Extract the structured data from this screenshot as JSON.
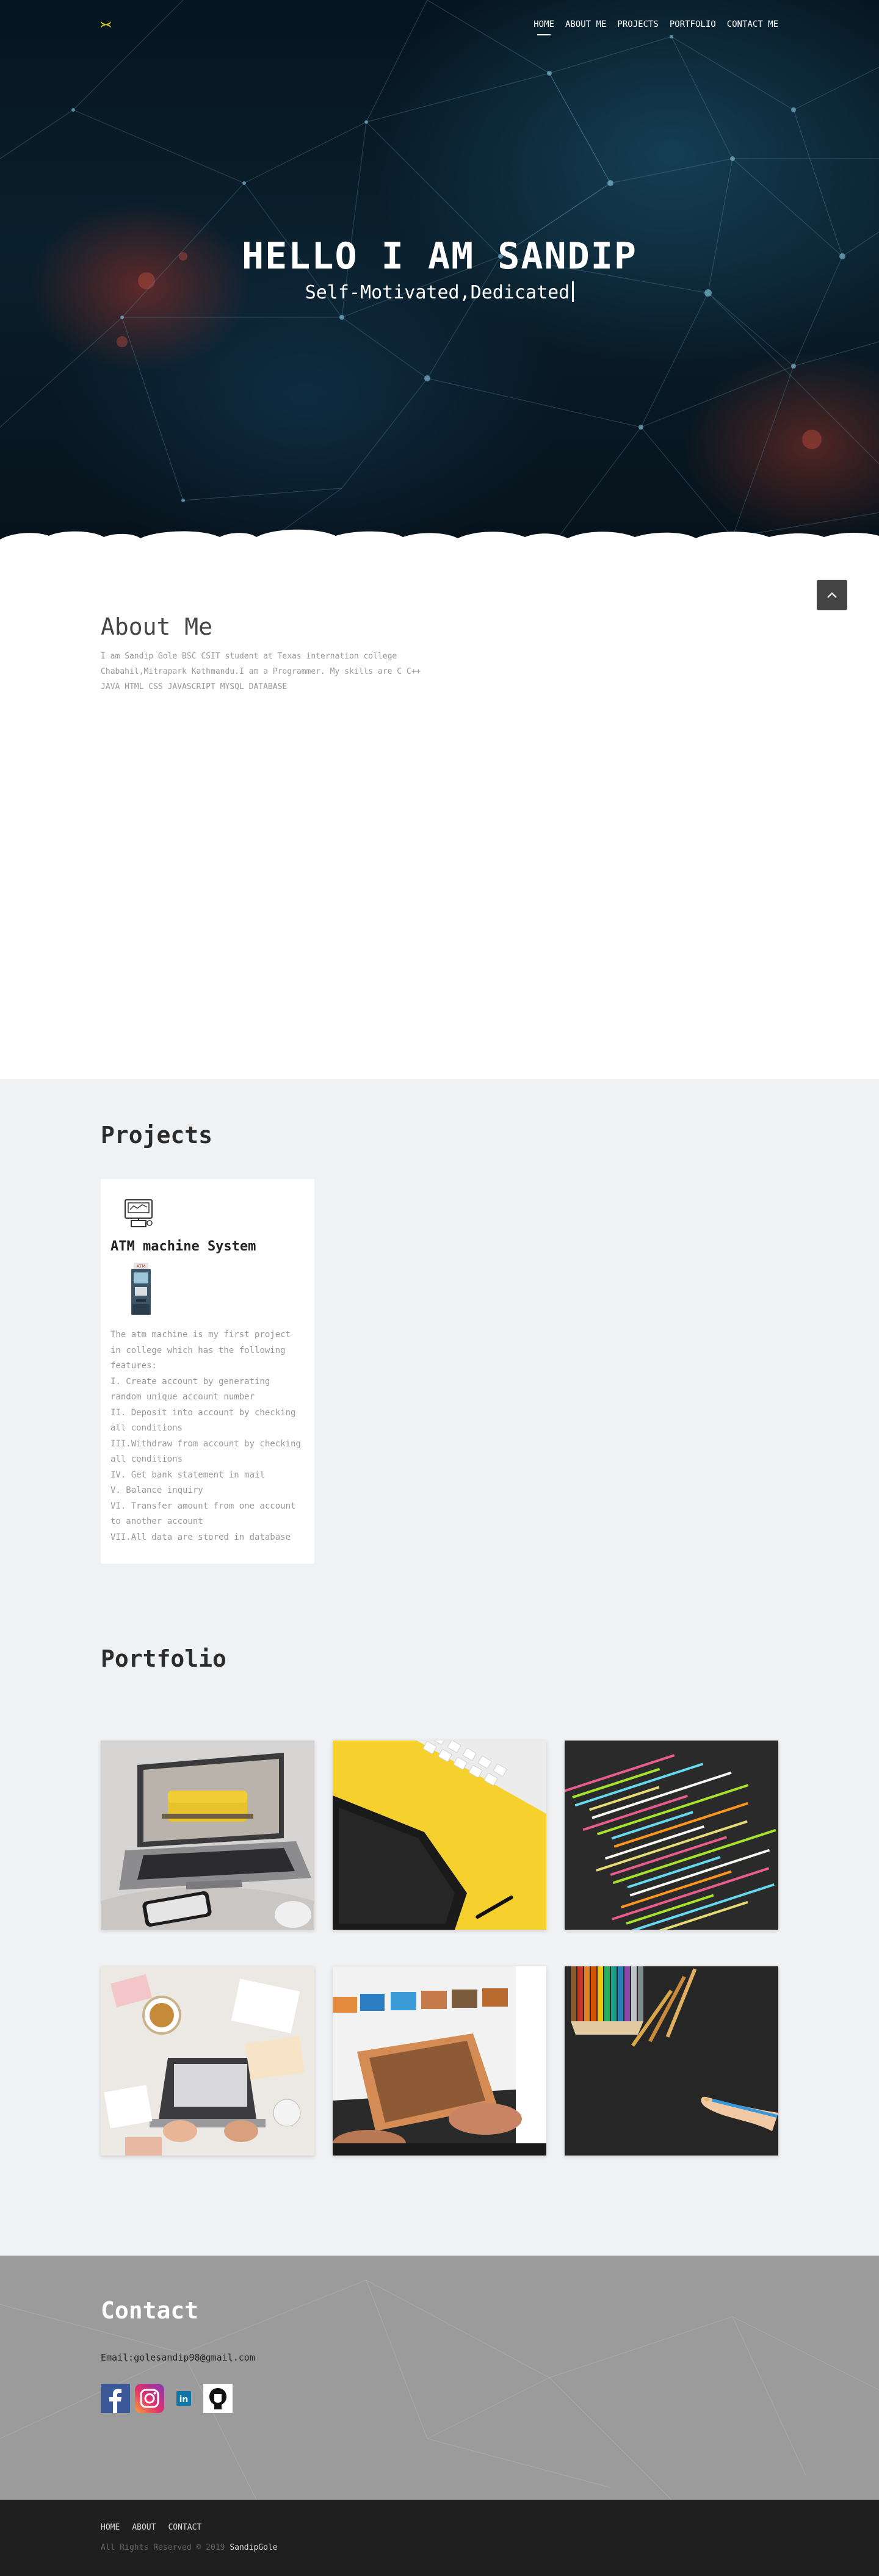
{
  "nav": {
    "logo": "≻≺",
    "links": [
      "HOME",
      "ABOUT ME",
      "PROJECTS",
      "PORTFOLIO",
      "CONTACT ME"
    ],
    "active": "HOME"
  },
  "hero": {
    "title": "HELLO I AM SANDIP",
    "subtitle": "Self-Motivated,Dedicated"
  },
  "about": {
    "title": "About Me",
    "text": "I am Sandip Gole BSC CSIT student at Texas internation college Chabahil,Mitrapark Kathmandu.I am a Programmer. My skills are C C++ JAVA HTML CSS JAVASCRIPT MYSQL DATABASE"
  },
  "projects": {
    "title": "Projects",
    "items": [
      {
        "title": "ATM machine System",
        "icon": "atm-illustration-icon",
        "description_lines": [
          "The atm machine is my first project in college which has the following features:",
          "I. Create account by generating random unique account number",
          "II. Deposit into account by checking all conditions",
          "III.Withdraw from account by checking all conditions",
          "IV. Get bank statement in mail",
          "V. Balance inquiry",
          "VI. Transfer amount from one account to another account",
          "VII.All data are stored in database"
        ]
      }
    ]
  },
  "portfolio": {
    "title": "Portfolio",
    "images": [
      "laptop-sofa-image",
      "keyboard-tablet-yellow-image",
      "code-screen-image",
      "team-desk-laptop-image",
      "photo-editing-image",
      "pencils-drawing-image"
    ]
  },
  "contact": {
    "title": "Contact",
    "email": "Email:golesandip98@gmail.com",
    "socials": [
      "facebook-icon",
      "instagram-icon",
      "linkedin-icon",
      "github-icon"
    ]
  },
  "footer": {
    "links": [
      "HOME",
      "ABOUT",
      "CONTACT"
    ],
    "copyright": "All Rights Reserved © 2019",
    "author": "SandipGole"
  },
  "colors": {
    "hero_bg": "#07151f",
    "logo": "#d4c832",
    "section_bg": "#f0f1f3",
    "contact_bg": "#9b9b9b",
    "footer_bg": "#1f1f1f"
  }
}
